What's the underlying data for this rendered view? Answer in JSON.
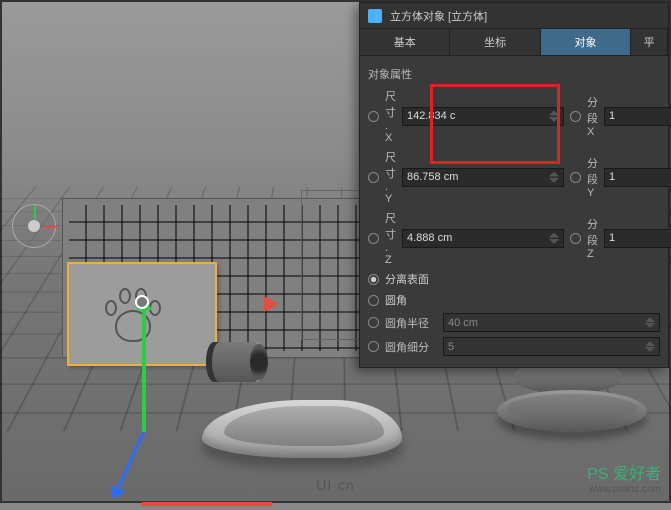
{
  "panel": {
    "title": "立方体对象 [立方体]",
    "tabs": [
      "基本",
      "坐标",
      "对象",
      "平"
    ],
    "active_tab": 2,
    "section_title": "对象属性",
    "size": {
      "x_label": "尺寸 . X",
      "x_value": "142.834 c",
      "y_label": "尺寸 . Y",
      "y_value": "86.758 cm",
      "z_label": "尺寸 . Z",
      "z_value": "4.888 cm"
    },
    "seg": {
      "x_label": "分段 X",
      "x_value": "1",
      "y_label": "分段 Y",
      "y_value": "1",
      "z_label": "分段 Z",
      "z_value": "1"
    },
    "opts": {
      "separate": "分离表面",
      "fillet": "圆角",
      "fillet_radius_label": "圆角半径",
      "fillet_radius_value": "40 cm",
      "fillet_sub_label": "圆角细分",
      "fillet_sub_value": "5"
    }
  },
  "watermark": {
    "center": "UI·cn",
    "right_top": "PS 爱好者",
    "right_bottom": "www.psahz.com"
  }
}
